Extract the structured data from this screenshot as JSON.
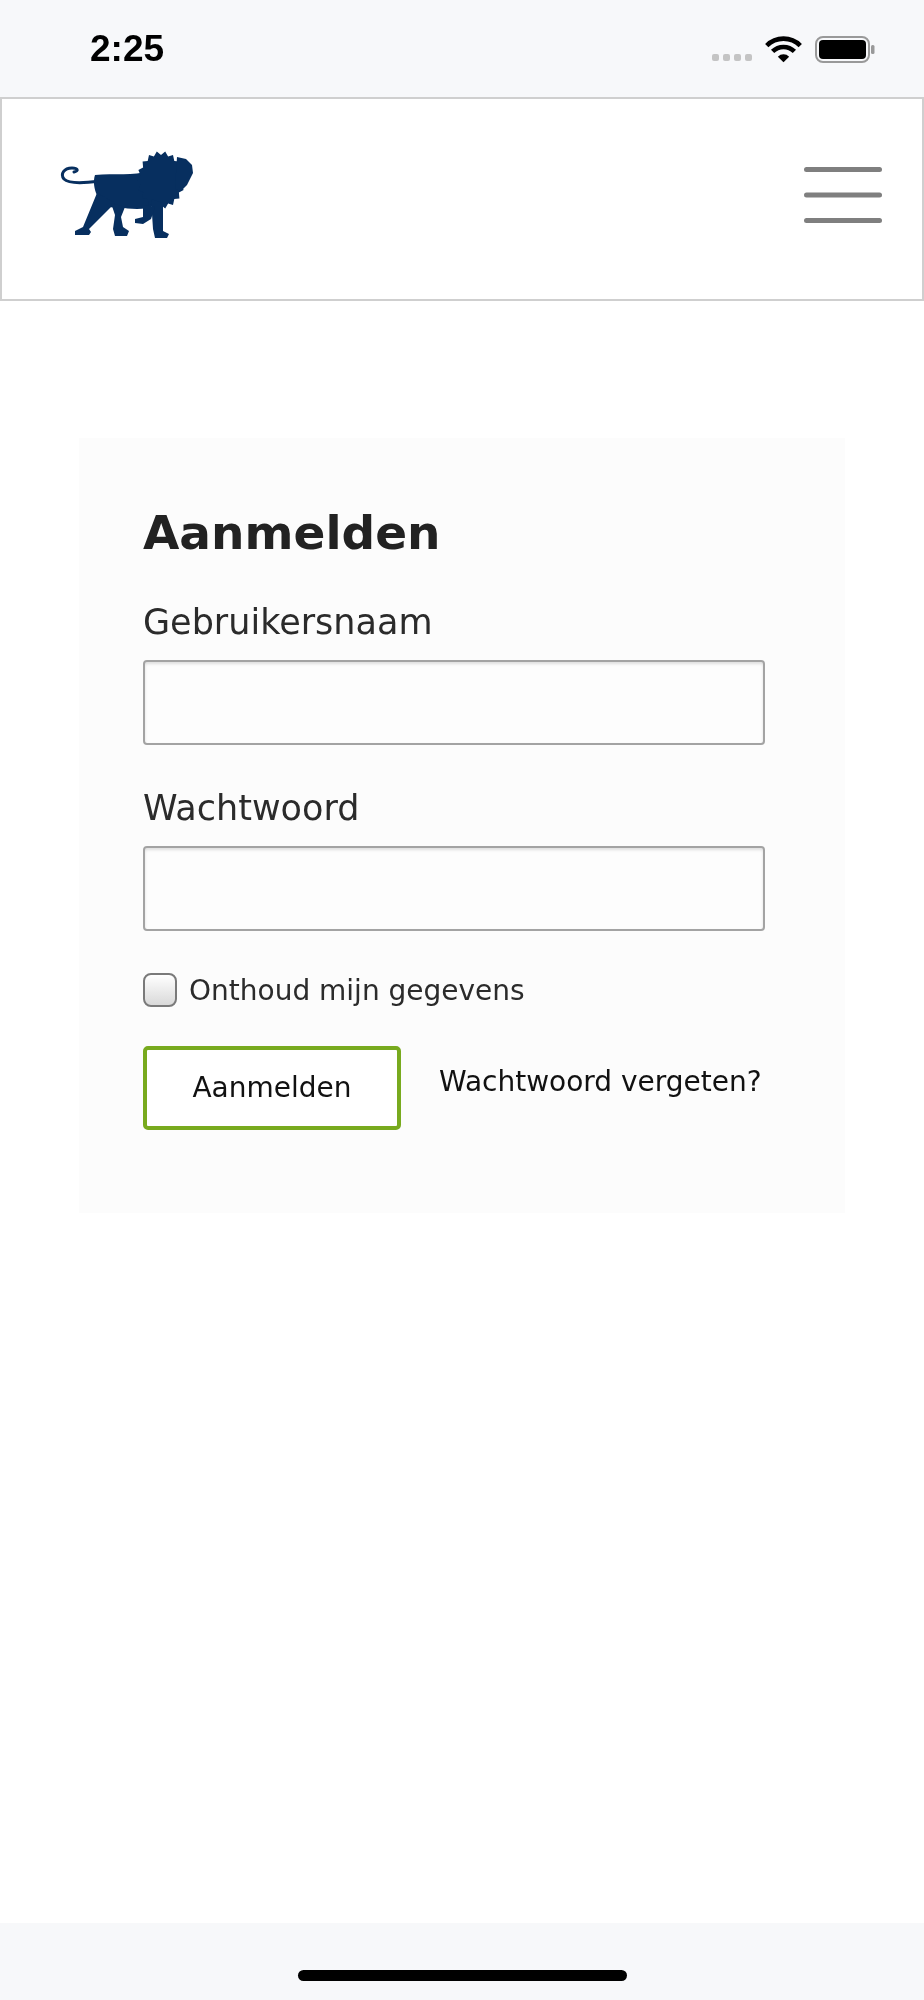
{
  "status_bar": {
    "time": "2:25"
  },
  "login": {
    "title": "Aanmelden",
    "fields": [
      {
        "label": "Gebruikersnaam"
      },
      {
        "label": "Wachtwoord"
      }
    ],
    "remember_me": {
      "label": "Onthoud mijn gegevens",
      "checked": false
    },
    "submit_button": {
      "label": "Aanmelden"
    },
    "forgot_password_link": {
      "label": "Wachtwoord vergeten?"
    }
  }
}
